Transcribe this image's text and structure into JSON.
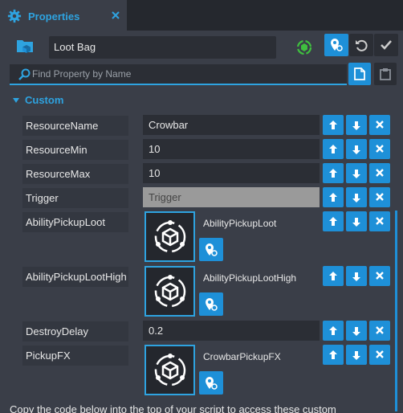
{
  "tab": {
    "title": "Properties",
    "gear_icon": "gear-icon",
    "close_icon": "close-icon"
  },
  "header": {
    "object_name": "Loot Bag",
    "object_icon": "folder-object-icon",
    "networked_icon": "networked-icon",
    "buttons": [
      "location-pin-icon",
      "undo-icon",
      "checkmark-icon"
    ]
  },
  "search": {
    "placeholder": "Find Property by Name",
    "icons": [
      "search-icon",
      "copy-icon",
      "paste-icon"
    ]
  },
  "section": {
    "title": "Custom"
  },
  "properties": [
    {
      "name": "ResourceName",
      "value": "Crowbar"
    },
    {
      "name": "ResourceMin",
      "value": "10"
    },
    {
      "name": "ResourceMax",
      "value": "10"
    },
    {
      "name": "Trigger",
      "value": "Trigger"
    },
    {
      "name": "AbilityPickupLoot",
      "asset": "AbilityPickupLoot"
    },
    {
      "name": "AbilityPickupLootHigh",
      "asset": "AbilityPickupLootHigh"
    },
    {
      "name": "DestroyDelay",
      "value": "0.2"
    },
    {
      "name": "PickupFX",
      "asset": "CrowbarPickupFX"
    }
  ],
  "row_buttons": [
    "arrow-up-icon",
    "arrow-down-icon",
    "close-icon"
  ],
  "footer": {
    "text": "Copy the code below into the top of your script to access these custom"
  },
  "colors": {
    "accent": "#1e90d8",
    "panel": "#3a3e48",
    "field": "#2b2e35"
  }
}
